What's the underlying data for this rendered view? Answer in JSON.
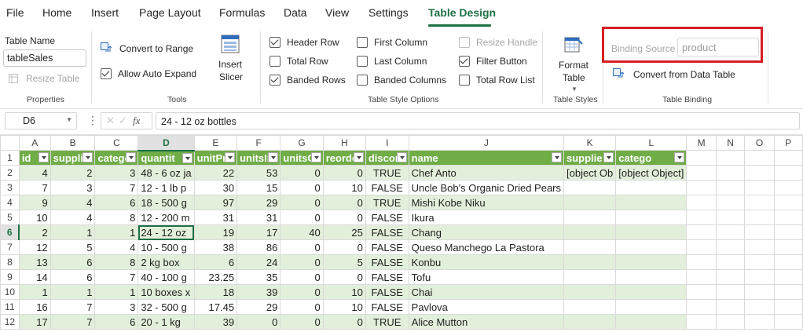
{
  "menu": {
    "tabs": [
      {
        "label": "File"
      },
      {
        "label": "Home"
      },
      {
        "label": "Insert"
      },
      {
        "label": "Page Layout"
      },
      {
        "label": "Formulas"
      },
      {
        "label": "Data"
      },
      {
        "label": "View"
      },
      {
        "label": "Settings"
      },
      {
        "label": "Table Design",
        "active": true
      }
    ]
  },
  "ribbon": {
    "properties": {
      "table_name_label": "Table Name",
      "table_name_value": "tableSales",
      "resize_table": "Resize Table",
      "group": "Properties"
    },
    "tools": {
      "convert_to_range": "Convert to Range",
      "allow_auto_expand": "Allow Auto Expand",
      "insert_slicer_1": "Insert",
      "insert_slicer_2": "Slicer",
      "group": "Tools"
    },
    "style_options": {
      "header_row": "Header Row",
      "total_row": "Total Row",
      "banded_rows": "Banded Rows",
      "first_column": "First Column",
      "last_column": "Last Column",
      "banded_columns": "Banded Columns",
      "resize_handle": "Resize Handle",
      "filter_button": "Filter Button",
      "total_row_list": "Total Row List",
      "group": "Table Style Options"
    },
    "table_styles": {
      "format_table_1": "Format",
      "format_table_2": "Table",
      "group": "Table Styles"
    },
    "binding": {
      "label": "Binding Source",
      "placeholder": "product",
      "convert": "Convert from Data Table",
      "group": "Table Binding"
    },
    "colors": {
      "accent": "#1e7145",
      "highlight_box": "#d81e26"
    }
  },
  "formula_bar": {
    "cell_ref": "D6",
    "fx": "fx",
    "formula": "24 - 12 oz bottles"
  },
  "sheet": {
    "columns": [
      "A",
      "B",
      "C",
      "D",
      "E",
      "F",
      "G",
      "H",
      "I",
      "J",
      "K",
      "L",
      "M",
      "N",
      "O",
      "P"
    ],
    "headers": [
      "id",
      "supplie",
      "catego",
      "quantit",
      "unitPri",
      "unitsIn",
      "unitsO",
      "reorde",
      "discon",
      "name",
      "supplie",
      "catego"
    ],
    "rows": [
      {
        "n": "2",
        "cells": [
          "4",
          "2",
          "3",
          "48 - 6 oz ja",
          "22",
          "53",
          "0",
          "0",
          "TRUE",
          "Chef Anto",
          "[object Ob",
          "[object Object]"
        ]
      },
      {
        "n": "3",
        "cells": [
          "7",
          "3",
          "7",
          "12 - 1 lb p",
          "30",
          "15",
          "0",
          "10",
          "FALSE",
          "Uncle Bob's Organic Dried Pears",
          "",
          ""
        ]
      },
      {
        "n": "4",
        "cells": [
          "9",
          "4",
          "6",
          "18 - 500 g",
          "97",
          "29",
          "0",
          "0",
          "TRUE",
          "Mishi Kobe Niku",
          "",
          ""
        ]
      },
      {
        "n": "5",
        "cells": [
          "10",
          "4",
          "8",
          "12 - 200 m",
          "31",
          "31",
          "0",
          "0",
          "FALSE",
          "Ikura",
          "",
          ""
        ]
      },
      {
        "n": "6",
        "cells": [
          "2",
          "1",
          "1",
          "24 - 12 oz",
          "19",
          "17",
          "40",
          "25",
          "FALSE",
          "Chang",
          "",
          ""
        ]
      },
      {
        "n": "7",
        "cells": [
          "12",
          "5",
          "4",
          "10 - 500 g",
          "38",
          "86",
          "0",
          "0",
          "FALSE",
          "Queso Manchego La Pastora",
          "",
          ""
        ]
      },
      {
        "n": "8",
        "cells": [
          "13",
          "6",
          "8",
          "2 kg box",
          "6",
          "24",
          "0",
          "5",
          "FALSE",
          "Konbu",
          "",
          ""
        ]
      },
      {
        "n": "9",
        "cells": [
          "14",
          "6",
          "7",
          "40 - 100 g",
          "23.25",
          "35",
          "0",
          "0",
          "FALSE",
          "Tofu",
          "",
          ""
        ]
      },
      {
        "n": "10",
        "cells": [
          "1",
          "1",
          "1",
          "10 boxes x",
          "18",
          "39",
          "0",
          "10",
          "FALSE",
          "Chai",
          "",
          ""
        ]
      },
      {
        "n": "11",
        "cells": [
          "16",
          "7",
          "3",
          "32 - 500 g",
          "17.45",
          "29",
          "0",
          "10",
          "FALSE",
          "Pavlova",
          "",
          ""
        ]
      },
      {
        "n": "12",
        "cells": [
          "17",
          "7",
          "6",
          "20 - 1 kg",
          "39",
          "0",
          "0",
          "0",
          "TRUE",
          "Alice Mutton",
          "",
          ""
        ]
      }
    ]
  }
}
